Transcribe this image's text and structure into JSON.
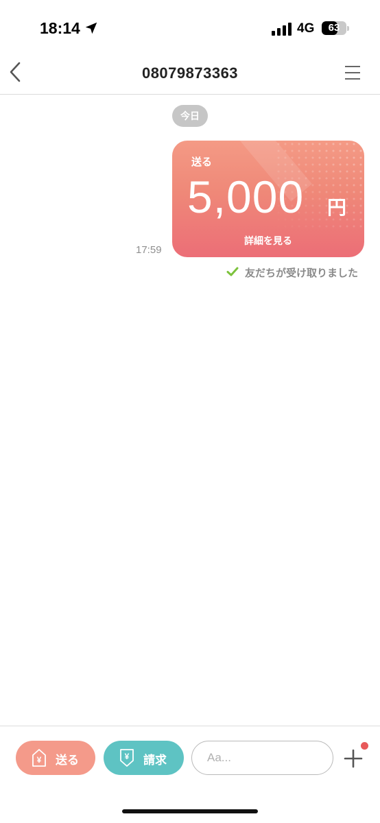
{
  "status_bar": {
    "time": "18:14",
    "network": "4G",
    "battery_level": "63",
    "icons": [
      "location-arrow-icon",
      "cellular-signal-icon",
      "battery-icon"
    ]
  },
  "nav": {
    "title": "08079873363",
    "icons": [
      "chevron-left-icon",
      "hamburger-menu-icon"
    ]
  },
  "chat": {
    "date_label": "今日",
    "messages": [
      {
        "time": "17:59",
        "card": {
          "label": "送る",
          "amount": "5,000",
          "unit": "円",
          "details_link": "詳細を見る"
        },
        "status": "友だちが受け取りました"
      }
    ]
  },
  "bottom_bar": {
    "send_label": "送る",
    "request_label": "請求",
    "input_placeholder": "Aa...",
    "input_value": "",
    "icons": [
      "yen-send-icon",
      "yen-request-icon",
      "plus-icon"
    ]
  },
  "colors": {
    "card_top": "#f49a85",
    "card_bottom": "#ec6e77",
    "send_button": "#f49a8a",
    "request_button": "#5ec3c3",
    "check_green": "#7cc23c",
    "notification_dot": "#e8595a"
  }
}
